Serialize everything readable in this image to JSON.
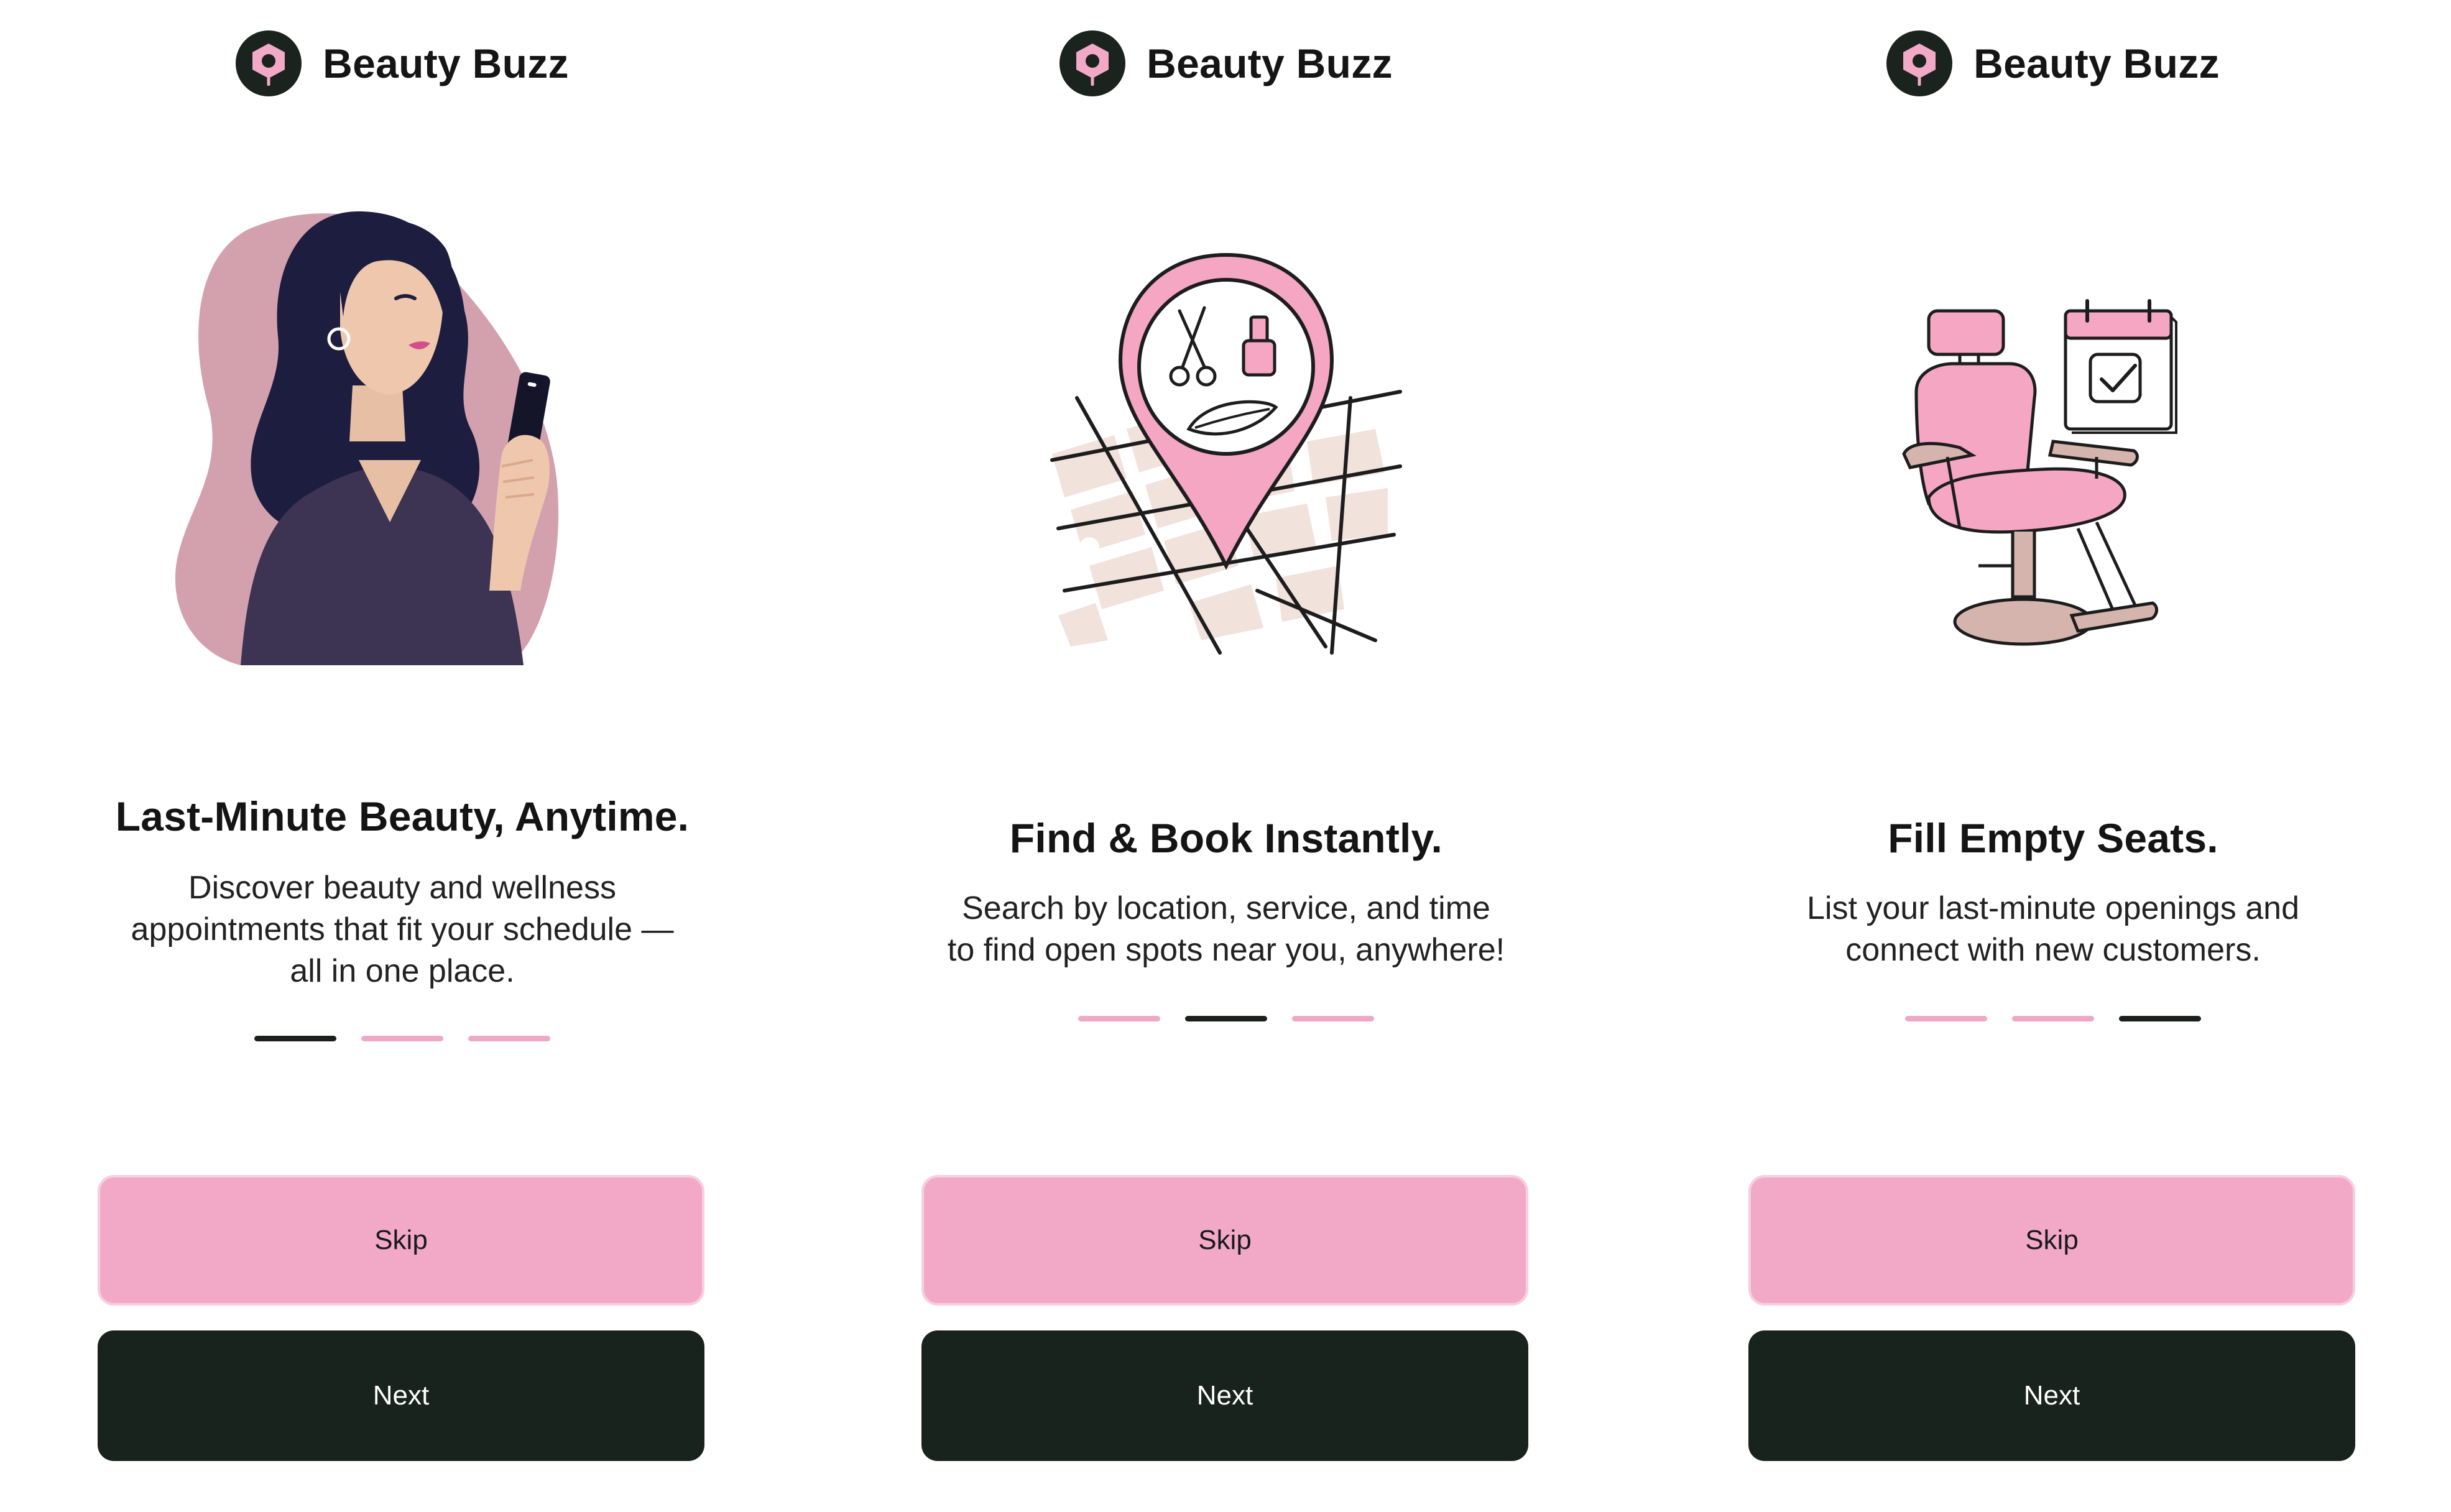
{
  "brand": {
    "name": "Beauty Buzz"
  },
  "colors": {
    "pink": "#f2a9c8",
    "dark": "#19231d",
    "blush": "#d3a1ad",
    "purple": "#3d3352"
  },
  "screens": [
    {
      "illustration": "woman-with-phone",
      "title": "Last-Minute Beauty, Anytime.",
      "description": "Discover beauty and wellness\nappointments that fit your schedule —\nall in one place.",
      "active_step": 1,
      "total_steps": 3,
      "skip_label": "Skip",
      "next_label": "Next"
    },
    {
      "illustration": "map-pin-with-beauty-icons",
      "title": "Find & Book Instantly.",
      "description": "Search by location, service, and time\nto find open spots near you, anywhere!",
      "active_step": 2,
      "total_steps": 3,
      "skip_label": "Skip",
      "next_label": "Next"
    },
    {
      "illustration": "salon-chair-with-calendar",
      "title": "Fill Empty Seats.",
      "description": "List your last-minute openings and\nconnect with new customers.",
      "active_step": 3,
      "total_steps": 3,
      "skip_label": "Skip",
      "next_label": "Next"
    }
  ]
}
